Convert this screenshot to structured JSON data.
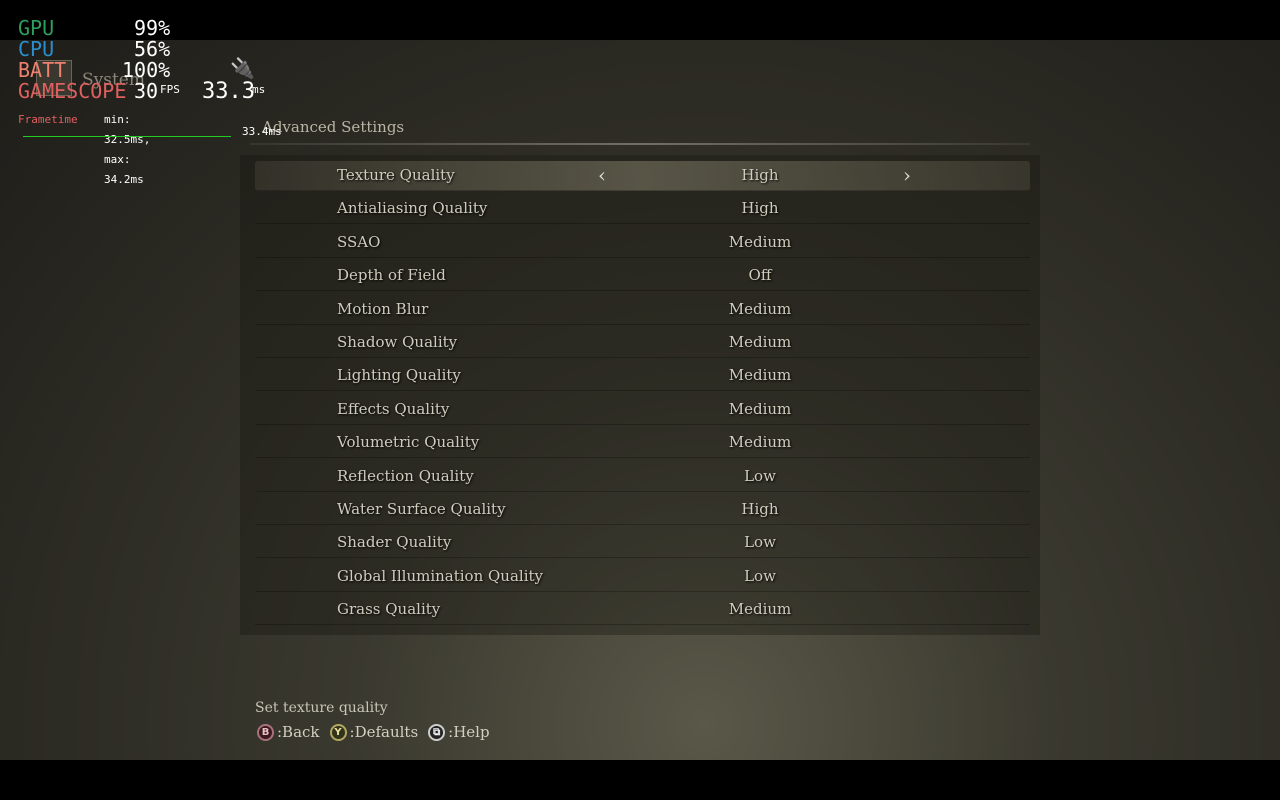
{
  "header": {
    "section": "System",
    "subsection": "Advanced Settings"
  },
  "settings": [
    {
      "label": "Texture Quality",
      "value": "High",
      "selected": true
    },
    {
      "label": "Antialiasing Quality",
      "value": "High"
    },
    {
      "label": "SSAO",
      "value": "Medium"
    },
    {
      "label": "Depth of Field",
      "value": "Off"
    },
    {
      "label": "Motion Blur",
      "value": "Medium"
    },
    {
      "label": "Shadow Quality",
      "value": "Medium"
    },
    {
      "label": "Lighting Quality",
      "value": "Medium"
    },
    {
      "label": "Effects Quality",
      "value": "Medium"
    },
    {
      "label": "Volumetric Quality",
      "value": "Medium"
    },
    {
      "label": "Reflection Quality",
      "value": "Low"
    },
    {
      "label": "Water Surface Quality",
      "value": "High"
    },
    {
      "label": "Shader Quality",
      "value": "Low"
    },
    {
      "label": "Global Illumination Quality",
      "value": "Low"
    },
    {
      "label": "Grass Quality",
      "value": "Medium"
    }
  ],
  "arrows": {
    "left": "‹",
    "right": "›"
  },
  "hint": "Set texture quality",
  "footer": [
    {
      "key": "B",
      "label": ":Back"
    },
    {
      "key": "Y",
      "label": ":Defaults"
    },
    {
      "key": "⧉",
      "label": ":Help"
    }
  ],
  "overlay": {
    "gpu_label": "GPU",
    "gpu": "99%",
    "cpu_label": "CPU",
    "cpu": "56%",
    "batt_label": "BATT",
    "batt": "100%",
    "gs_label": "GAMESCOPE",
    "fps": "30",
    "fps_unit": "FPS",
    "frametime_ms": "33.3",
    "ms_unit": "ms",
    "ft_label": "Frametime",
    "ft_minmax": "min: 32.5ms, max: 34.2ms",
    "ft_current": "33.4ms",
    "colors": {
      "gpu": "#2e9e5e",
      "cpu": "#2a8fcc",
      "batt": "#f08070",
      "gamescope": "#e06060",
      "graph": "#22cc22"
    },
    "charging_icon": "plug-icon"
  }
}
